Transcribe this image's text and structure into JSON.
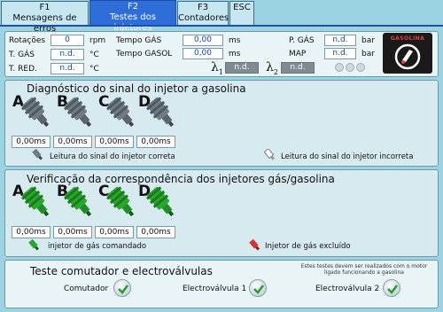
{
  "tabs": [
    {
      "key": "F1",
      "label": "Mensagens de erros"
    },
    {
      "key": "F2",
      "label": "Testes dos injetores"
    },
    {
      "key": "F3",
      "label": "Contadores"
    },
    {
      "key": "ESC",
      "label": ""
    }
  ],
  "active_tab": 1,
  "status": {
    "rotacoes_label": "Rotações",
    "rotacoes_value": "0",
    "rotacoes_unit": "rpm",
    "tgas_label": "T. GÁS",
    "tgas_value": "n.d.",
    "tgas_unit": "°C",
    "tred_label": "T. RED.",
    "tred_value": "n.d.",
    "tred_unit": "°C",
    "tempo_gas_label": "Tempo GÁS",
    "tempo_gas_value": "0,00",
    "tempo_gas_unit": "ms",
    "tempo_gasol_label": "Tempo GASOL",
    "tempo_gasol_value": "0,00",
    "tempo_gasol_unit": "ms",
    "lambda1_value": "n.d.",
    "lambda2_value": "n.d.",
    "pgas_label": "P. GÁS",
    "pgas_value": "n.d.",
    "pgas_unit": "bar",
    "map_label": "MAP",
    "map_value": "n.d.",
    "map_unit": "bar",
    "logo_text": "GASOLINA"
  },
  "diag": {
    "title": "Diagnóstico do sinal do injetor a gasolina",
    "injectors": [
      {
        "letter": "A",
        "value": "0,00ms"
      },
      {
        "letter": "B",
        "value": "0,00ms"
      },
      {
        "letter": "C",
        "value": "0,00ms"
      },
      {
        "letter": "D",
        "value": "0,00ms"
      }
    ],
    "legend_ok": "Leitura do sinal do injetor correta",
    "legend_bad": "Leitura do sinal do injetor incorreta"
  },
  "verif": {
    "title": "Verificação da correspondência dos injetores gás/gasolina",
    "injectors": [
      {
        "letter": "A",
        "value": "0,00ms"
      },
      {
        "letter": "B",
        "value": "0,00ms"
      },
      {
        "letter": "C",
        "value": "0,00ms"
      },
      {
        "letter": "D",
        "value": "0,00ms"
      }
    ],
    "legend_cmd": "injetor de gás comandado",
    "legend_excl": "Injetor de gás excluído"
  },
  "switch": {
    "title": "Teste comutador e electroválvulas",
    "note": "Estes testes devem ser realizados com o motor ligado funcionando a gasolina",
    "items": [
      {
        "label": "Comutador"
      },
      {
        "label": "Electroválvula 1"
      },
      {
        "label": "Electroválvula 2"
      }
    ]
  },
  "colors": {
    "active_tab": "#2f6ed8",
    "background": "#9bd3e3",
    "injector_grey": "#6f7c83",
    "injector_green": "#27a82b",
    "excluded_red": "#d93030"
  },
  "icons": {
    "injector": "fuel-injector-icon",
    "check": "check-icon",
    "logo": "gasoline-logo-icon"
  }
}
